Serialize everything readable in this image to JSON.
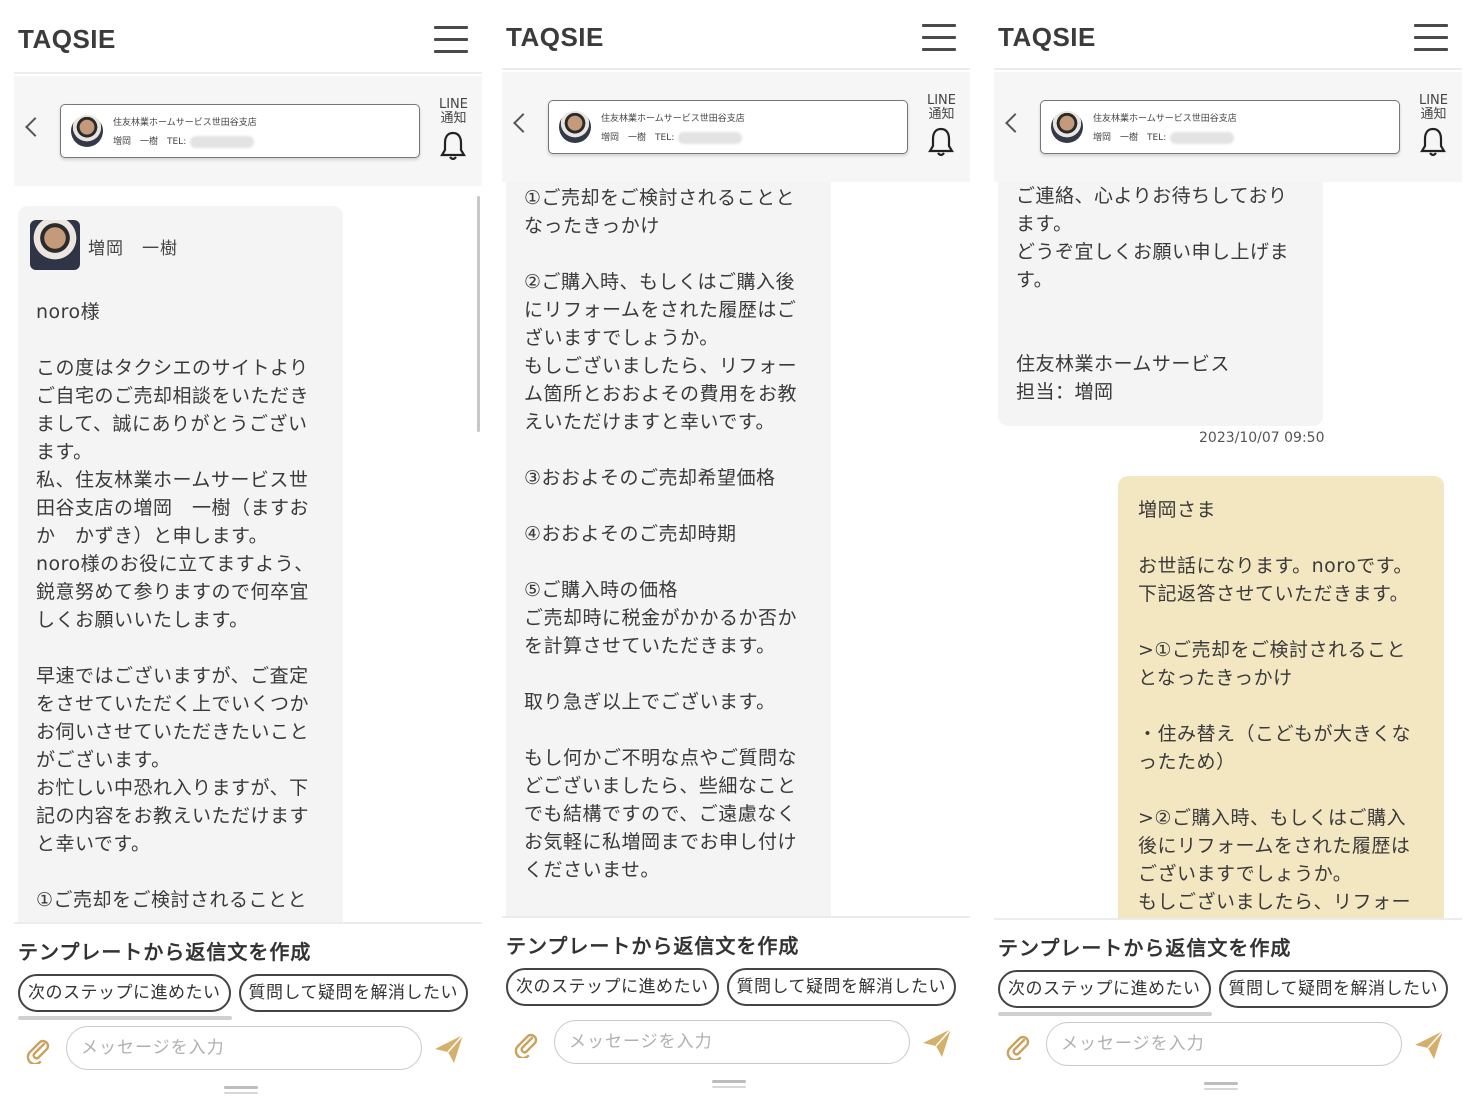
{
  "logo": "TAQSIE",
  "agent": {
    "card_line1": "住友林業ホームサービス世田谷支店",
    "card_line2": "増岡　一樹　TEL:",
    "line_label_1": "LINE",
    "line_label_2": "通知"
  },
  "panel1": {
    "sender_name": "増岡　一樹",
    "message": "noro様\n\nこの度はタクシエのサイトより\nご自宅のご売却相談をいただき\nまして、誠にありがとうござい\nます。\n私、住友林業ホームサービス世\n田谷支店の増岡　一樹（ますお\nか　かずき）と申します。\nnoro様のお役に立てますよう、\n鋭意努めて参りますので何卒宜\nしくお願いいたします。\n\n早速ではございますが、ご査定\nをさせていただく上でいくつか\nお伺いさせていただきたいこと\nがございます。\nお忙しい中恐れ入りますが、下\n記の内容をお教えいただけます\nと幸いです。\n\n①ご売却をご検討されることと"
  },
  "panel2": {
    "message": "①ご売却をご検討されることと\nなったきっかけ\n\n②ご購入時、もしくはご購入後\nにリフォームをされた履歴はご\nざいますでしょうか。\nもしございましたら、リフォー\nム箇所とおおよその費用をお教\nえいただけますと幸いです。\n\n③おおよそのご売却希望価格\n\n④おおよそのご売却時期\n\n⑤ご購入時の価格\nご売却時に税金がかかるか否か\nを計算させていただきます。\n\n取り急ぎ以上でございます。\n\nもし何かご不明な点やご質問な\nどございましたら、些細なこと\nでも結構ですので、ご遠慮なく\nお気軽に私増岡までお申し付け\nくださいませ。"
  },
  "panel3": {
    "message": "ご連絡、心よりお待ちしており\nます。\nどうぞ宜しくお願い申し上げま\nす。\n\n\n住友林業ホームサービス\n担当：増岡",
    "timestamp": "2023/10/07 09:50",
    "reply": "増岡さま\n\nお世話になります。noroです。\n下記返答させていただきます。\n\n>①ご売却をご検討されること\nとなったきっかけ\n\n・住み替え（こどもが大きくな\nったため）\n\n>②ご購入時、もしくはご購入\n後にリフォームをされた履歴は\nございますでしょうか。\nもしございましたら、リフォー"
  },
  "bottom": {
    "template_title": "テンプレートから返信文を作成",
    "chip_1": "次のステップに進めたい",
    "chip_2": "質問して疑問を解消したい",
    "placeholder": "メッセージを入力"
  },
  "icons": [
    "hamburger-menu-icon",
    "back-chevron-icon",
    "bell-icon",
    "paperclip-icon",
    "send-icon"
  ],
  "colors": {
    "reply_bubble": "#f3e7c2",
    "agent_bubble": "#f4f4f4",
    "send_accent": "#d4b06a"
  }
}
